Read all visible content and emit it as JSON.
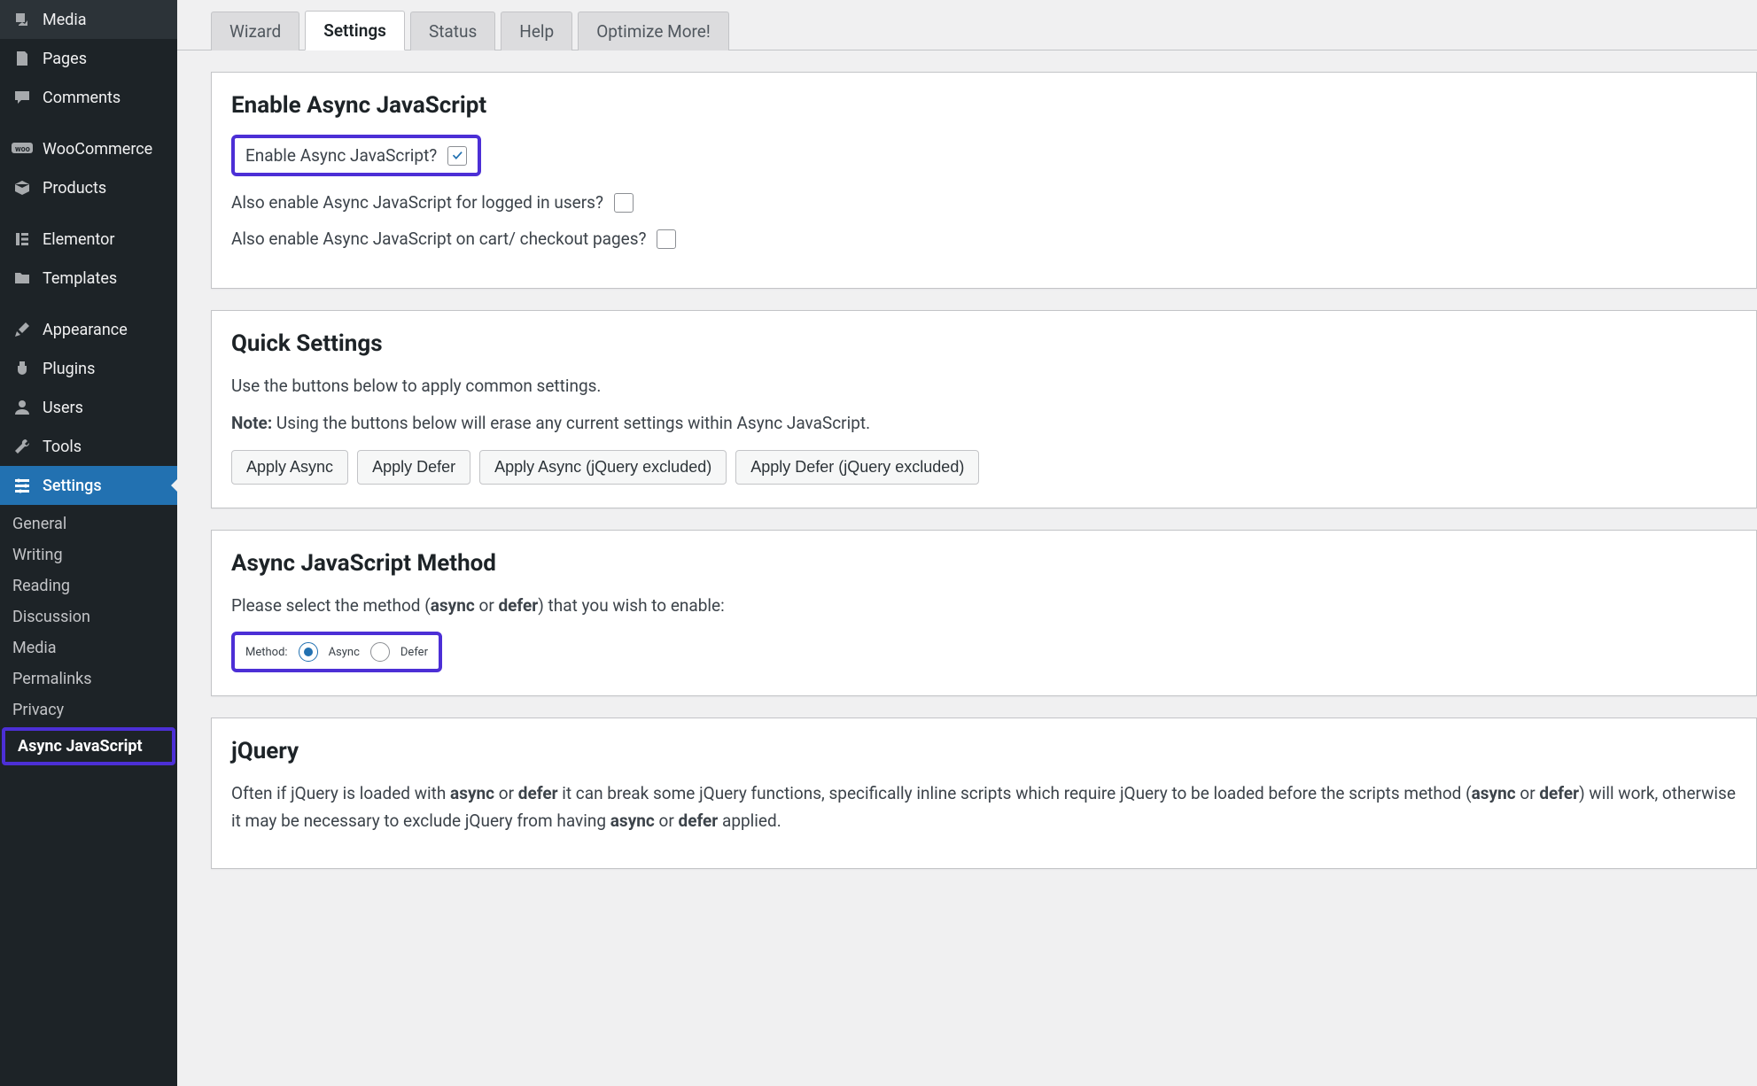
{
  "sidebar": {
    "items": [
      {
        "label": "Media",
        "icon": "media-icon"
      },
      {
        "label": "Pages",
        "icon": "page-icon"
      },
      {
        "label": "Comments",
        "icon": "comment-icon"
      },
      {
        "label": "WooCommerce",
        "icon": "woo-icon"
      },
      {
        "label": "Products",
        "icon": "cube-icon"
      },
      {
        "label": "Elementor",
        "icon": "elementor-icon"
      },
      {
        "label": "Templates",
        "icon": "folder-icon"
      },
      {
        "label": "Appearance",
        "icon": "brush-icon"
      },
      {
        "label": "Plugins",
        "icon": "plug-icon"
      },
      {
        "label": "Users",
        "icon": "user-icon"
      },
      {
        "label": "Tools",
        "icon": "wrench-icon"
      },
      {
        "label": "Settings",
        "icon": "slider-icon"
      }
    ],
    "submenu": [
      "General",
      "Writing",
      "Reading",
      "Discussion",
      "Media",
      "Permalinks",
      "Privacy",
      "Async JavaScript"
    ]
  },
  "tabs": [
    "Wizard",
    "Settings",
    "Status",
    "Help",
    "Optimize More!"
  ],
  "activeTab": "Settings",
  "panel1": {
    "title": "Enable Async JavaScript",
    "enable_label": "Enable Async JavaScript?",
    "logged_in_label": "Also enable Async JavaScript for logged in users?",
    "cart_label": "Also enable Async JavaScript on cart/ checkout pages?"
  },
  "panel2": {
    "title": "Quick Settings",
    "desc": "Use the buttons below to apply common settings.",
    "note_label": "Note:",
    "note_text": " Using the buttons below will erase any current settings within Async JavaScript.",
    "buttons": [
      "Apply Async",
      "Apply Defer",
      "Apply Async (jQuery excluded)",
      "Apply Defer (jQuery excluded)"
    ]
  },
  "panel3": {
    "title": "Async JavaScript Method",
    "desc_left": "Please select the method (",
    "desc_async": "async",
    "desc_or": " or ",
    "desc_defer": "defer",
    "desc_right": ") that you wish to enable:",
    "method_label": "Method:",
    "method_async": "Async",
    "method_defer": "Defer"
  },
  "panel4": {
    "title": "jQuery",
    "p_a": "Often if jQuery is loaded with ",
    "p_b": "async",
    "p_c": " or ",
    "p_d": "defer",
    "p_e": " it can break some jQuery functions, specifically inline scripts which require jQuery to be loaded before the scripts method (",
    "p_f": "async",
    "p_g": " or ",
    "p_h": "defer",
    "p_i": ") will work, otherwise it may be necessary to exclude jQuery from having ",
    "p_j": "async",
    "p_k": " or ",
    "p_l": "defer",
    "p_m": " applied."
  }
}
